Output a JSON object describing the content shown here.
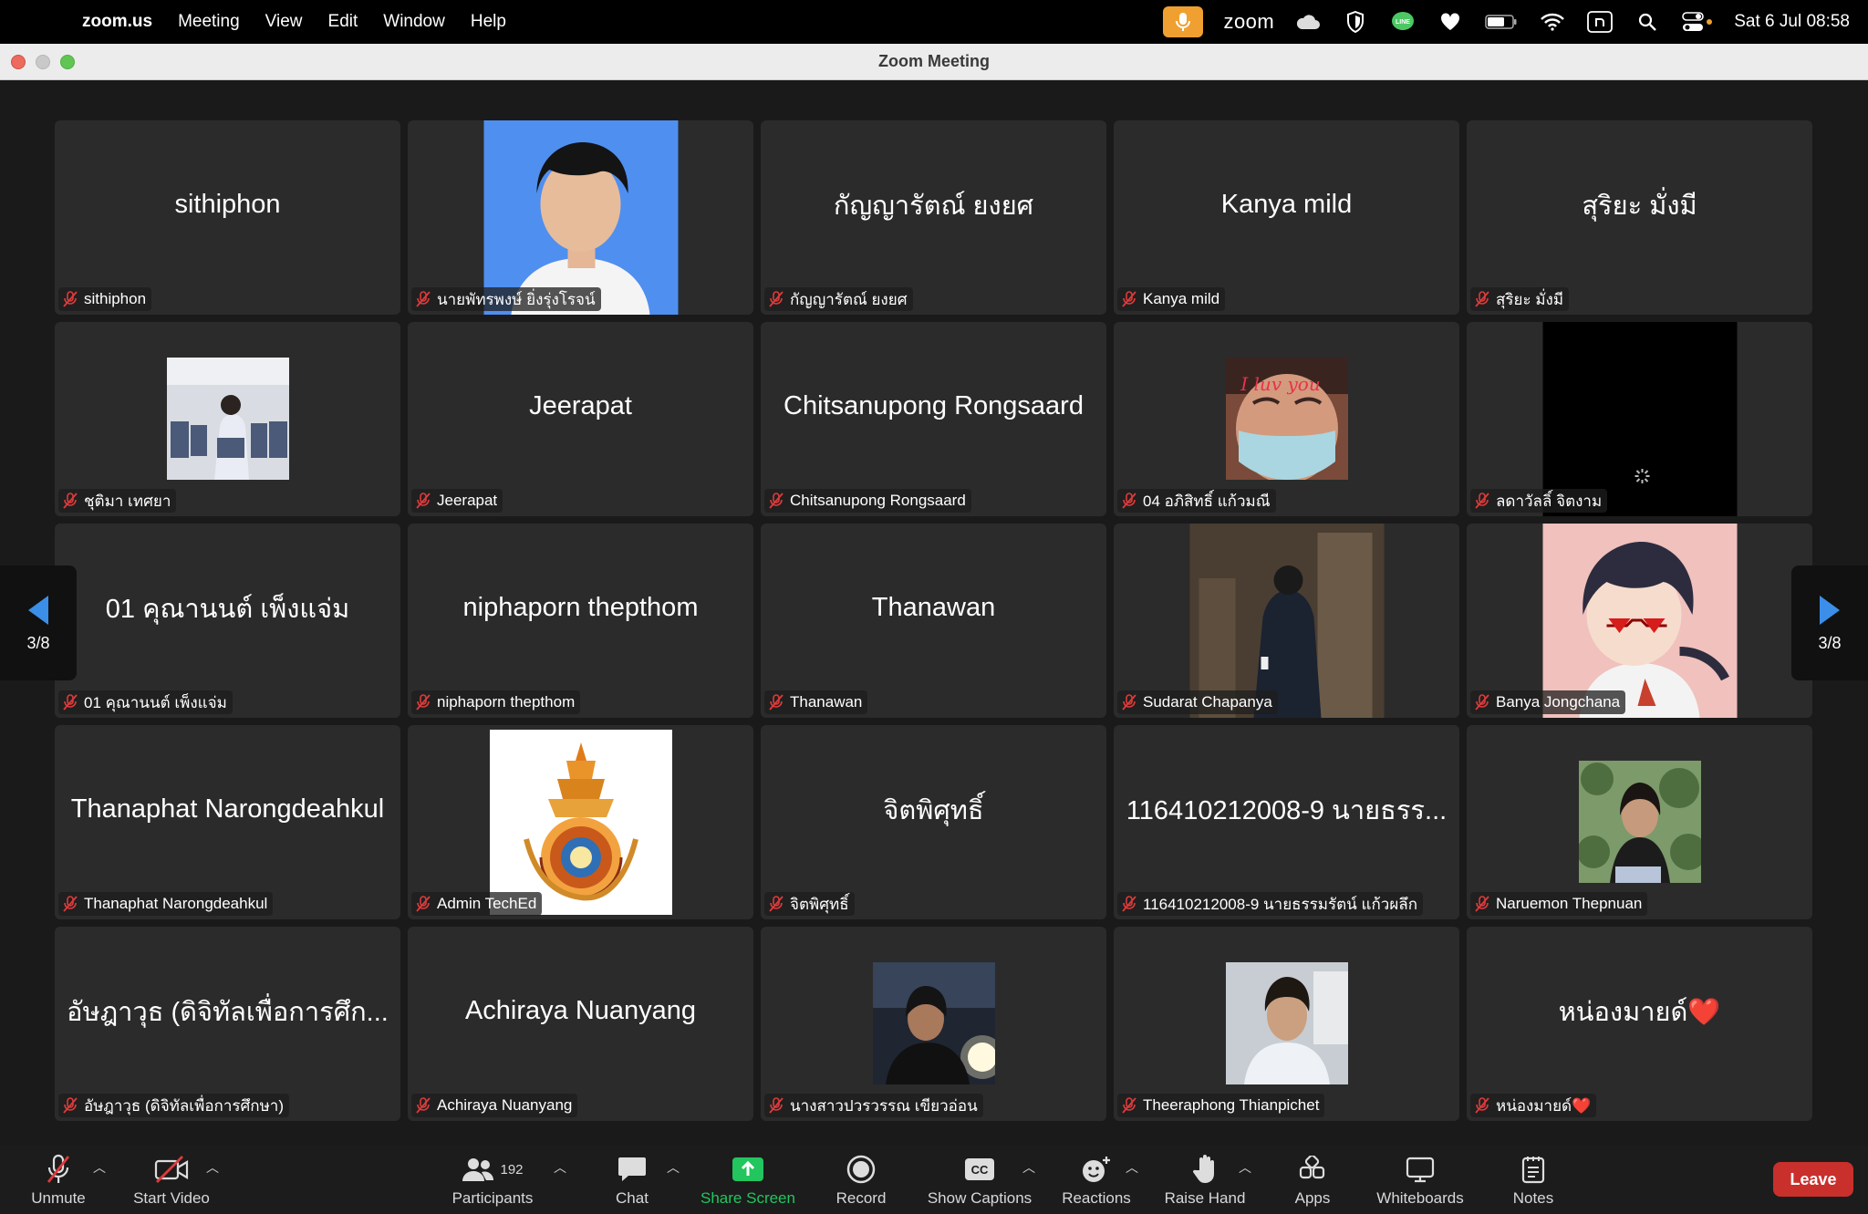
{
  "menubar": {
    "app_name": "zoom.us",
    "menus": [
      "Meeting",
      "View",
      "Edit",
      "Window",
      "Help"
    ],
    "zoom_tray": "zoom",
    "datetime": "Sat 6 Jul  08:58",
    "icons": [
      "microphone-icon",
      "cloud-icon",
      "shield-icon",
      "line-icon",
      "heart-icon",
      "battery-icon",
      "wifi-icon",
      "input-source-icon",
      "search-icon",
      "control-center-icon"
    ]
  },
  "window": {
    "title": "Zoom Meeting"
  },
  "gallery": {
    "page_left": "3/8",
    "page_right": "3/8",
    "tiles": [
      {
        "big": "sithiphon",
        "label": "sithiphon",
        "pic": ""
      },
      {
        "big": "",
        "label": "นายพัทรพงษ์ ยิ่งรุ่งโรจน์",
        "pic": "full-blue"
      },
      {
        "big": "กัญญารัตณ์ ยงยศ",
        "label": "กัญญารัตณ์ ยงยศ",
        "pic": ""
      },
      {
        "big": "Kanya mild",
        "label": "Kanya mild",
        "pic": ""
      },
      {
        "big": "สุริยะ มั่งมี",
        "label": "สุริยะ มั่งมี",
        "pic": ""
      },
      {
        "big": "",
        "label": "ชุติมา เทศยา",
        "pic": "small-classroom"
      },
      {
        "big": "Jeerapat",
        "label": "Jeerapat",
        "pic": ""
      },
      {
        "big": "Chitsanupong Rongsaard",
        "label": "Chitsanupong Rongsaard",
        "pic": ""
      },
      {
        "big": "",
        "label": "04 อภิสิทธิ์ แก้วมณี",
        "pic": "small-mask",
        "pic_text": "I luv you"
      },
      {
        "big": "",
        "label": "ลดาวัลลิ์ จิตงาม",
        "pic": "full-black"
      },
      {
        "big": "01 คุณานนต์ เพ็งแจ่ม",
        "label": "01 คุณานนต์ เพ็งแจ่ม",
        "pic": ""
      },
      {
        "big": "niphaporn thepthom",
        "label": "niphaporn thepthom",
        "pic": ""
      },
      {
        "big": "Thanawan",
        "label": "Thanawan",
        "pic": ""
      },
      {
        "big": "",
        "label": "Sudarat Chapanya",
        "pic": "full-dark-person"
      },
      {
        "big": "",
        "label": "Banya Jongchana",
        "pic": "full-anime"
      },
      {
        "big": "Thanaphat Narongdeahkul",
        "label": "Thanaphat Narongdeahkul",
        "pic": ""
      },
      {
        "big": "",
        "label": "Admin TechEd",
        "pic": "full-emblem"
      },
      {
        "big": "จิตพิศุทธิ์",
        "label": "จิตพิศุทธิ์",
        "pic": ""
      },
      {
        "big": "116410212008-9 นายธรร...",
        "label": "116410212008-9 นายธรรมรัตน์ แก้วผลึก",
        "pic": ""
      },
      {
        "big": "",
        "label": "Naruemon Thepnuan",
        "pic": "small-plants"
      },
      {
        "big": "อัษฎาวุธ (ดิจิทัลเพื่อการศึก...",
        "label": "อัษฎาวุธ (ดิจิทัลเพื่อการศึกษา)",
        "pic": ""
      },
      {
        "big": "Achiraya Nuanyang",
        "label": "Achiraya Nuanyang",
        "pic": ""
      },
      {
        "big": "",
        "label": "นางสาวปวรวรรณ เขียวอ่อน",
        "pic": "small-night"
      },
      {
        "big": "",
        "label": "Theeraphong Thianpichet",
        "pic": "small-student"
      },
      {
        "big": "หน่องมายด์❤️",
        "label": "หน่องมายด์❤️",
        "pic": ""
      }
    ]
  },
  "toolbar": {
    "unmute": "Unmute",
    "start_video": "Start Video",
    "participants": "Participants",
    "participants_count": "192",
    "chat": "Chat",
    "share_screen": "Share Screen",
    "record": "Record",
    "show_captions": "Show Captions",
    "reactions": "Reactions",
    "raise_hand": "Raise Hand",
    "apps": "Apps",
    "whiteboards": "Whiteboards",
    "notes": "Notes",
    "leave": "Leave",
    "cc_badge": "CC",
    "accent": "#22c55e",
    "leave_color": "#c9302c"
  }
}
